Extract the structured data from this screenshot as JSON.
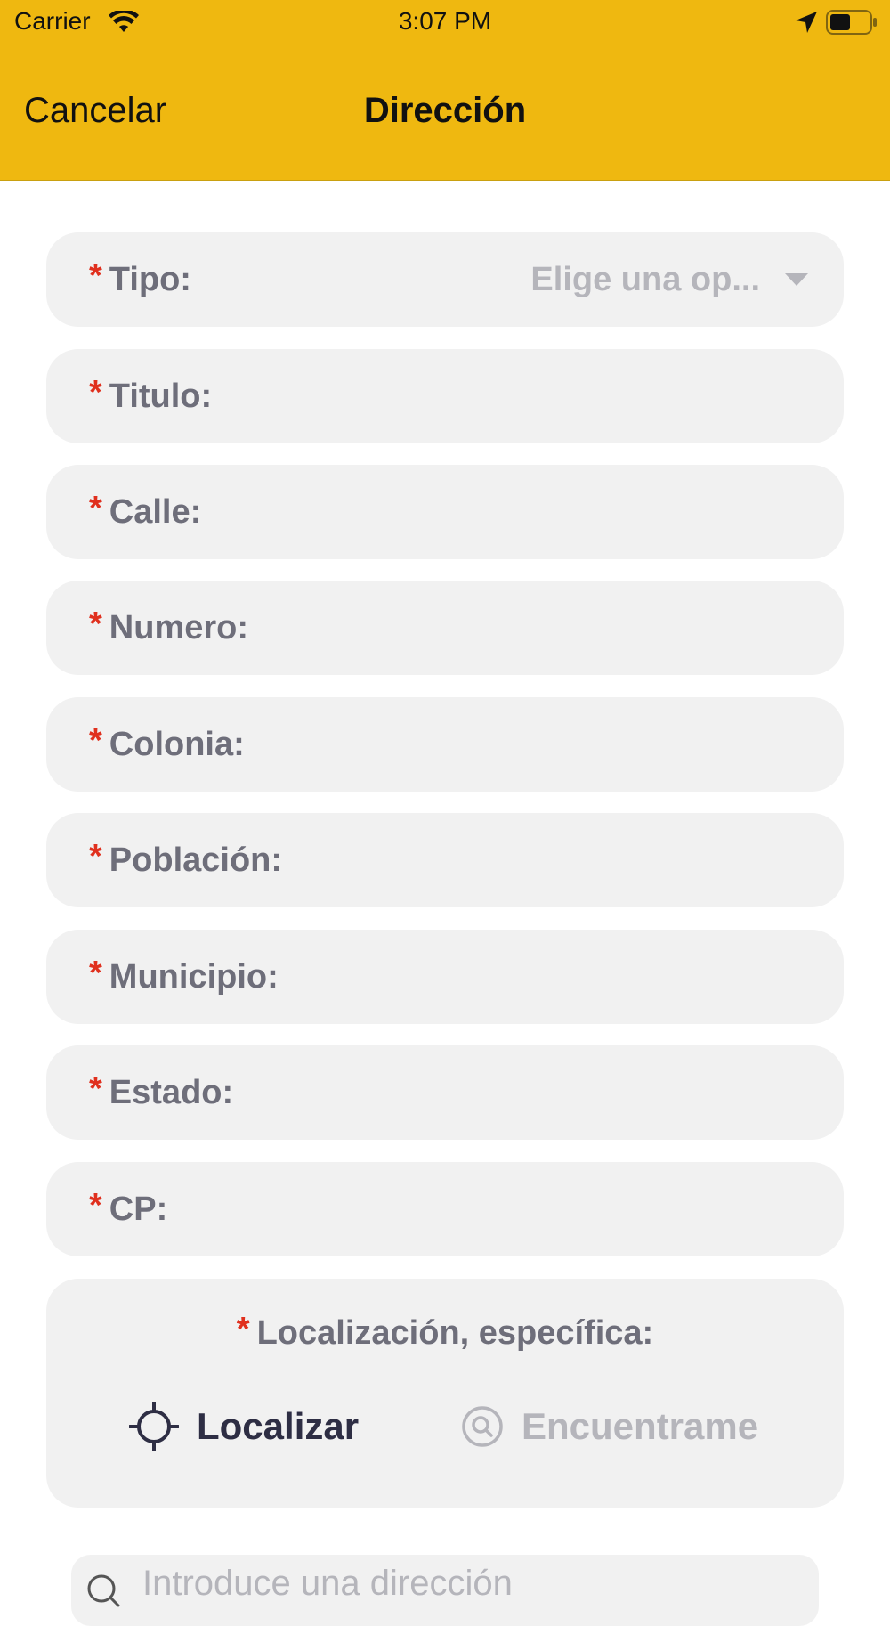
{
  "status_bar": {
    "carrier": "Carrier",
    "time": "3:07 PM"
  },
  "nav": {
    "cancel_label": "Cancelar",
    "title": "Dirección"
  },
  "colors": {
    "header": "#efb810",
    "required": "#e0301e",
    "field_bg": "#f1f1f1",
    "label": "#6e6e7a"
  },
  "form": {
    "required_mark": "*",
    "tipo": {
      "label": "Tipo:",
      "placeholder": "Elige una op..."
    },
    "fields": [
      {
        "label": "Titulo:",
        "value": ""
      },
      {
        "label": "Calle:",
        "value": ""
      },
      {
        "label": "Numero:",
        "value": ""
      },
      {
        "label": "Colonia:",
        "value": ""
      },
      {
        "label": "Población:",
        "value": ""
      },
      {
        "label": "Municipio:",
        "value": ""
      },
      {
        "label": "Estado:",
        "value": ""
      },
      {
        "label": "CP:",
        "value": ""
      }
    ],
    "location": {
      "label": "Localización, específica:",
      "localizar_label": "Localizar",
      "encuentrame_label": "Encuentrame"
    }
  },
  "search": {
    "placeholder": "Introduce una dirección"
  },
  "icons": {
    "wifi": "wifi-icon",
    "location": "location-arrow-icon",
    "battery": "battery-icon",
    "dropdown": "chevron-down-icon",
    "crosshair": "crosshair-icon",
    "find": "search-circle-icon"
  }
}
